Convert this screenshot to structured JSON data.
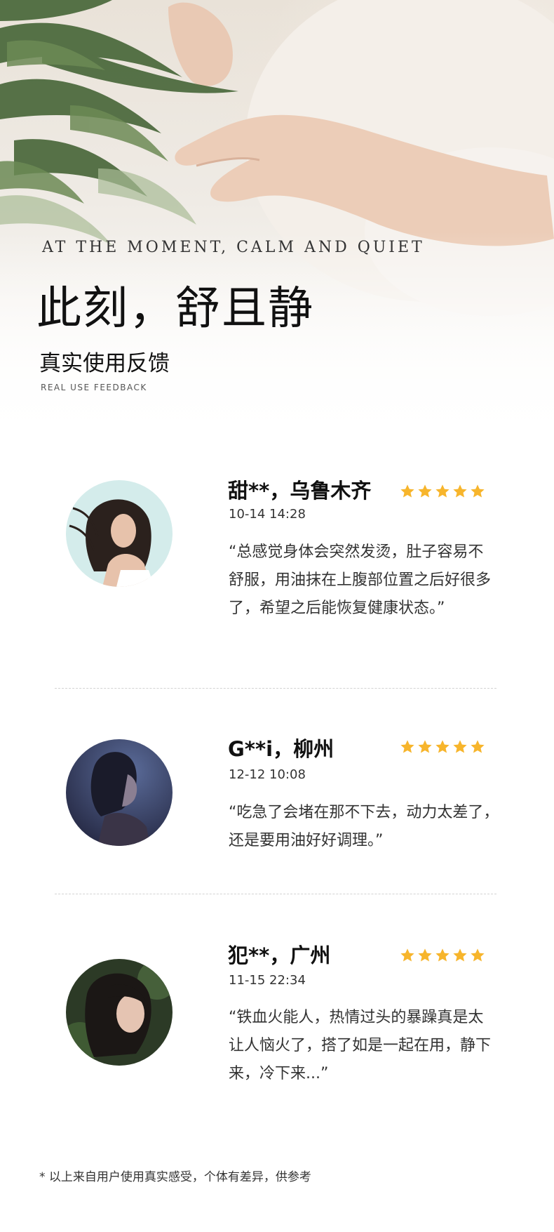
{
  "hero": {
    "en_heading": "AT THE MOMENT, CALM AND QUIET",
    "title": "此刻，舒且静",
    "subtitle": "真实使用反馈",
    "subtitle_en": "REAL USE FEEDBACK"
  },
  "colors": {
    "star": "#f7b52c",
    "divider": "#d2d2d2"
  },
  "reviews": [
    {
      "name": "甜**，乌鲁木齐",
      "date": "10-14 14:28",
      "rating": 5,
      "quote": "“总感觉身体会突然发烫，肚子容易不舒服，用油抹在上腹部位置之后好很多了，希望之后能恢复健康状态。”"
    },
    {
      "name": "G**i，柳州",
      "date": "12-12 10:08",
      "rating": 5,
      "quote": "“吃急了会堵在那不下去，动力太差了，还是要用油好好调理。”"
    },
    {
      "name": "犯**，广州",
      "date": "11-15 22:34",
      "rating": 5,
      "quote": "“铁血火能人，热情过头的暴躁真是太让人恼火了，搭了如是一起在用，静下来，冷下来...”"
    }
  ],
  "footnote": "* 以上来自用户使用真实感受，个体有差异，供参考"
}
